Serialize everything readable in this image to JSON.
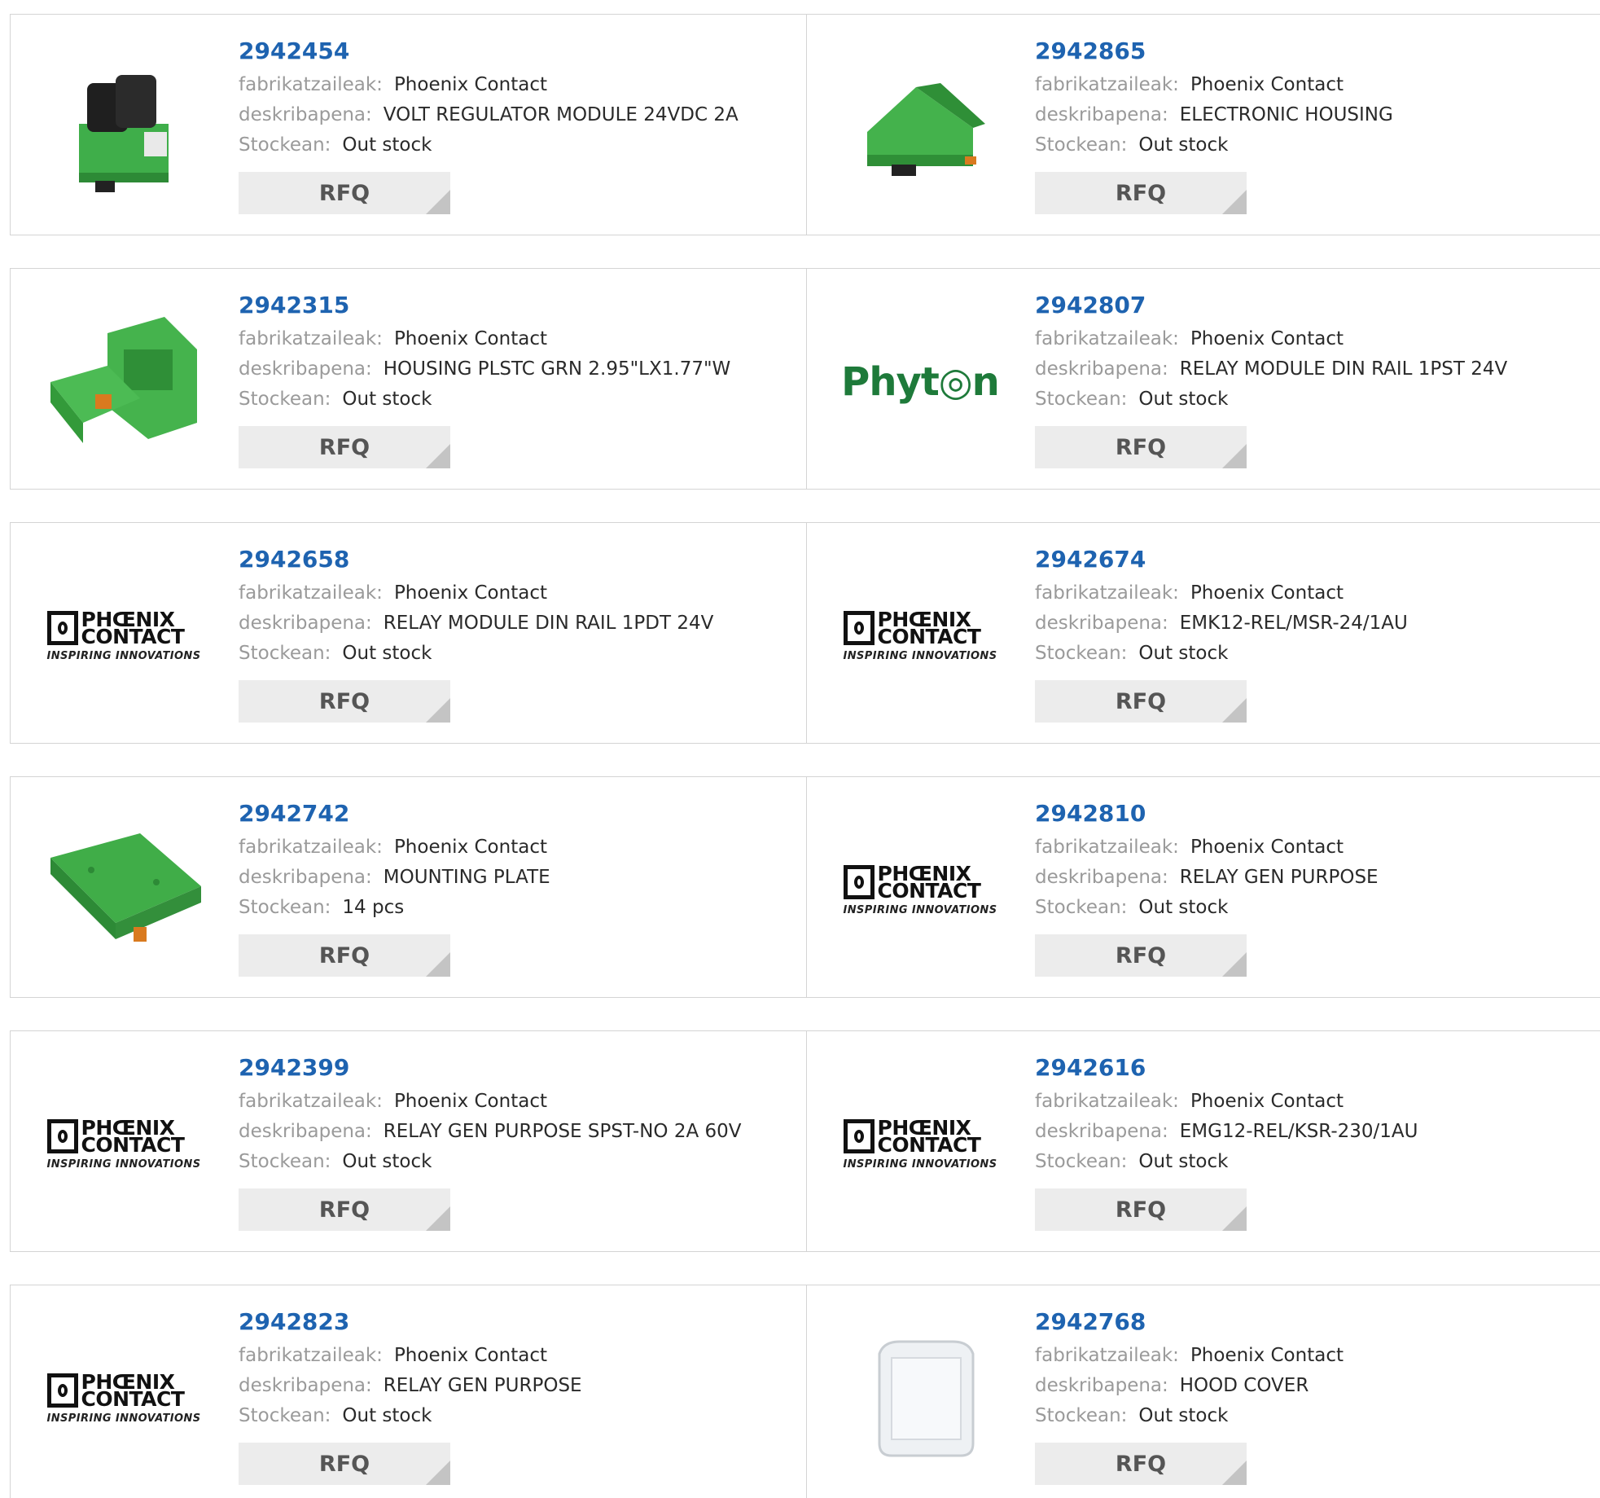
{
  "labels": {
    "manufacturer": "fabrikatzaileak:",
    "description": "deskribapena:",
    "stock": "Stockean:",
    "rfq": "RFQ"
  },
  "logos": {
    "phoenix_line1": "PHŒNIX",
    "phoenix_line2": "CONTACT",
    "phoenix_tagline": "INSPIRING INNOVATIONS",
    "phyton": "Phyt◎n"
  },
  "colors": {
    "link": "#1e63b0",
    "product_green": "#3fae4a"
  },
  "rows": [
    [
      {
        "part": "2942454",
        "manufacturer": "Phoenix Contact",
        "description": "VOLT REGULATOR MODULE 24VDC 2A",
        "stock": "Out stock",
        "image": "green-module-with-black-top-photo"
      },
      {
        "part": "2942865",
        "manufacturer": "Phoenix Contact",
        "description": "ELECTRONIC HOUSING",
        "stock": "Out stock",
        "image": "green-housing-photo"
      }
    ],
    [
      {
        "part": "2942315",
        "manufacturer": "Phoenix Contact",
        "description": "HOUSING PLSTC GRN 2.95\"LX1.77\"W",
        "stock": "Out stock",
        "image": "green-housing-parts-photo"
      },
      {
        "part": "2942807",
        "manufacturer": "Phoenix Contact",
        "description": "RELAY MODULE DIN RAIL 1PST 24V",
        "stock": "Out stock",
        "image": "phyton-logo"
      }
    ],
    [
      {
        "part": "2942658",
        "manufacturer": "Phoenix Contact",
        "description": "RELAY MODULE DIN RAIL 1PDT 24V",
        "stock": "Out stock",
        "image": "phoenix-contact-logo"
      },
      {
        "part": "2942674",
        "manufacturer": "Phoenix Contact",
        "description": "EMK12-REL/MSR-24/1AU",
        "stock": "Out stock",
        "image": "phoenix-contact-logo"
      }
    ],
    [
      {
        "part": "2942742",
        "manufacturer": "Phoenix Contact",
        "description": "MOUNTING PLATE",
        "stock": "14 pcs",
        "image": "green-mounting-plate-photo"
      },
      {
        "part": "2942810",
        "manufacturer": "Phoenix Contact",
        "description": "RELAY GEN PURPOSE",
        "stock": "Out stock",
        "image": "phoenix-contact-logo"
      }
    ],
    [
      {
        "part": "2942399",
        "manufacturer": "Phoenix Contact",
        "description": "RELAY GEN PURPOSE SPST-NO 2A 60V",
        "stock": "Out stock",
        "image": "phoenix-contact-logo"
      },
      {
        "part": "2942616",
        "manufacturer": "Phoenix Contact",
        "description": "EMG12-REL/KSR-230/1AU",
        "stock": "Out stock",
        "image": "phoenix-contact-logo"
      }
    ],
    [
      {
        "part": "2942823",
        "manufacturer": "Phoenix Contact",
        "description": "RELAY GEN PURPOSE",
        "stock": "Out stock",
        "image": "phoenix-contact-logo"
      },
      {
        "part": "2942768",
        "manufacturer": "Phoenix Contact",
        "description": "HOOD COVER",
        "stock": "Out stock",
        "image": "clear-hood-cover-photo"
      }
    ]
  ]
}
